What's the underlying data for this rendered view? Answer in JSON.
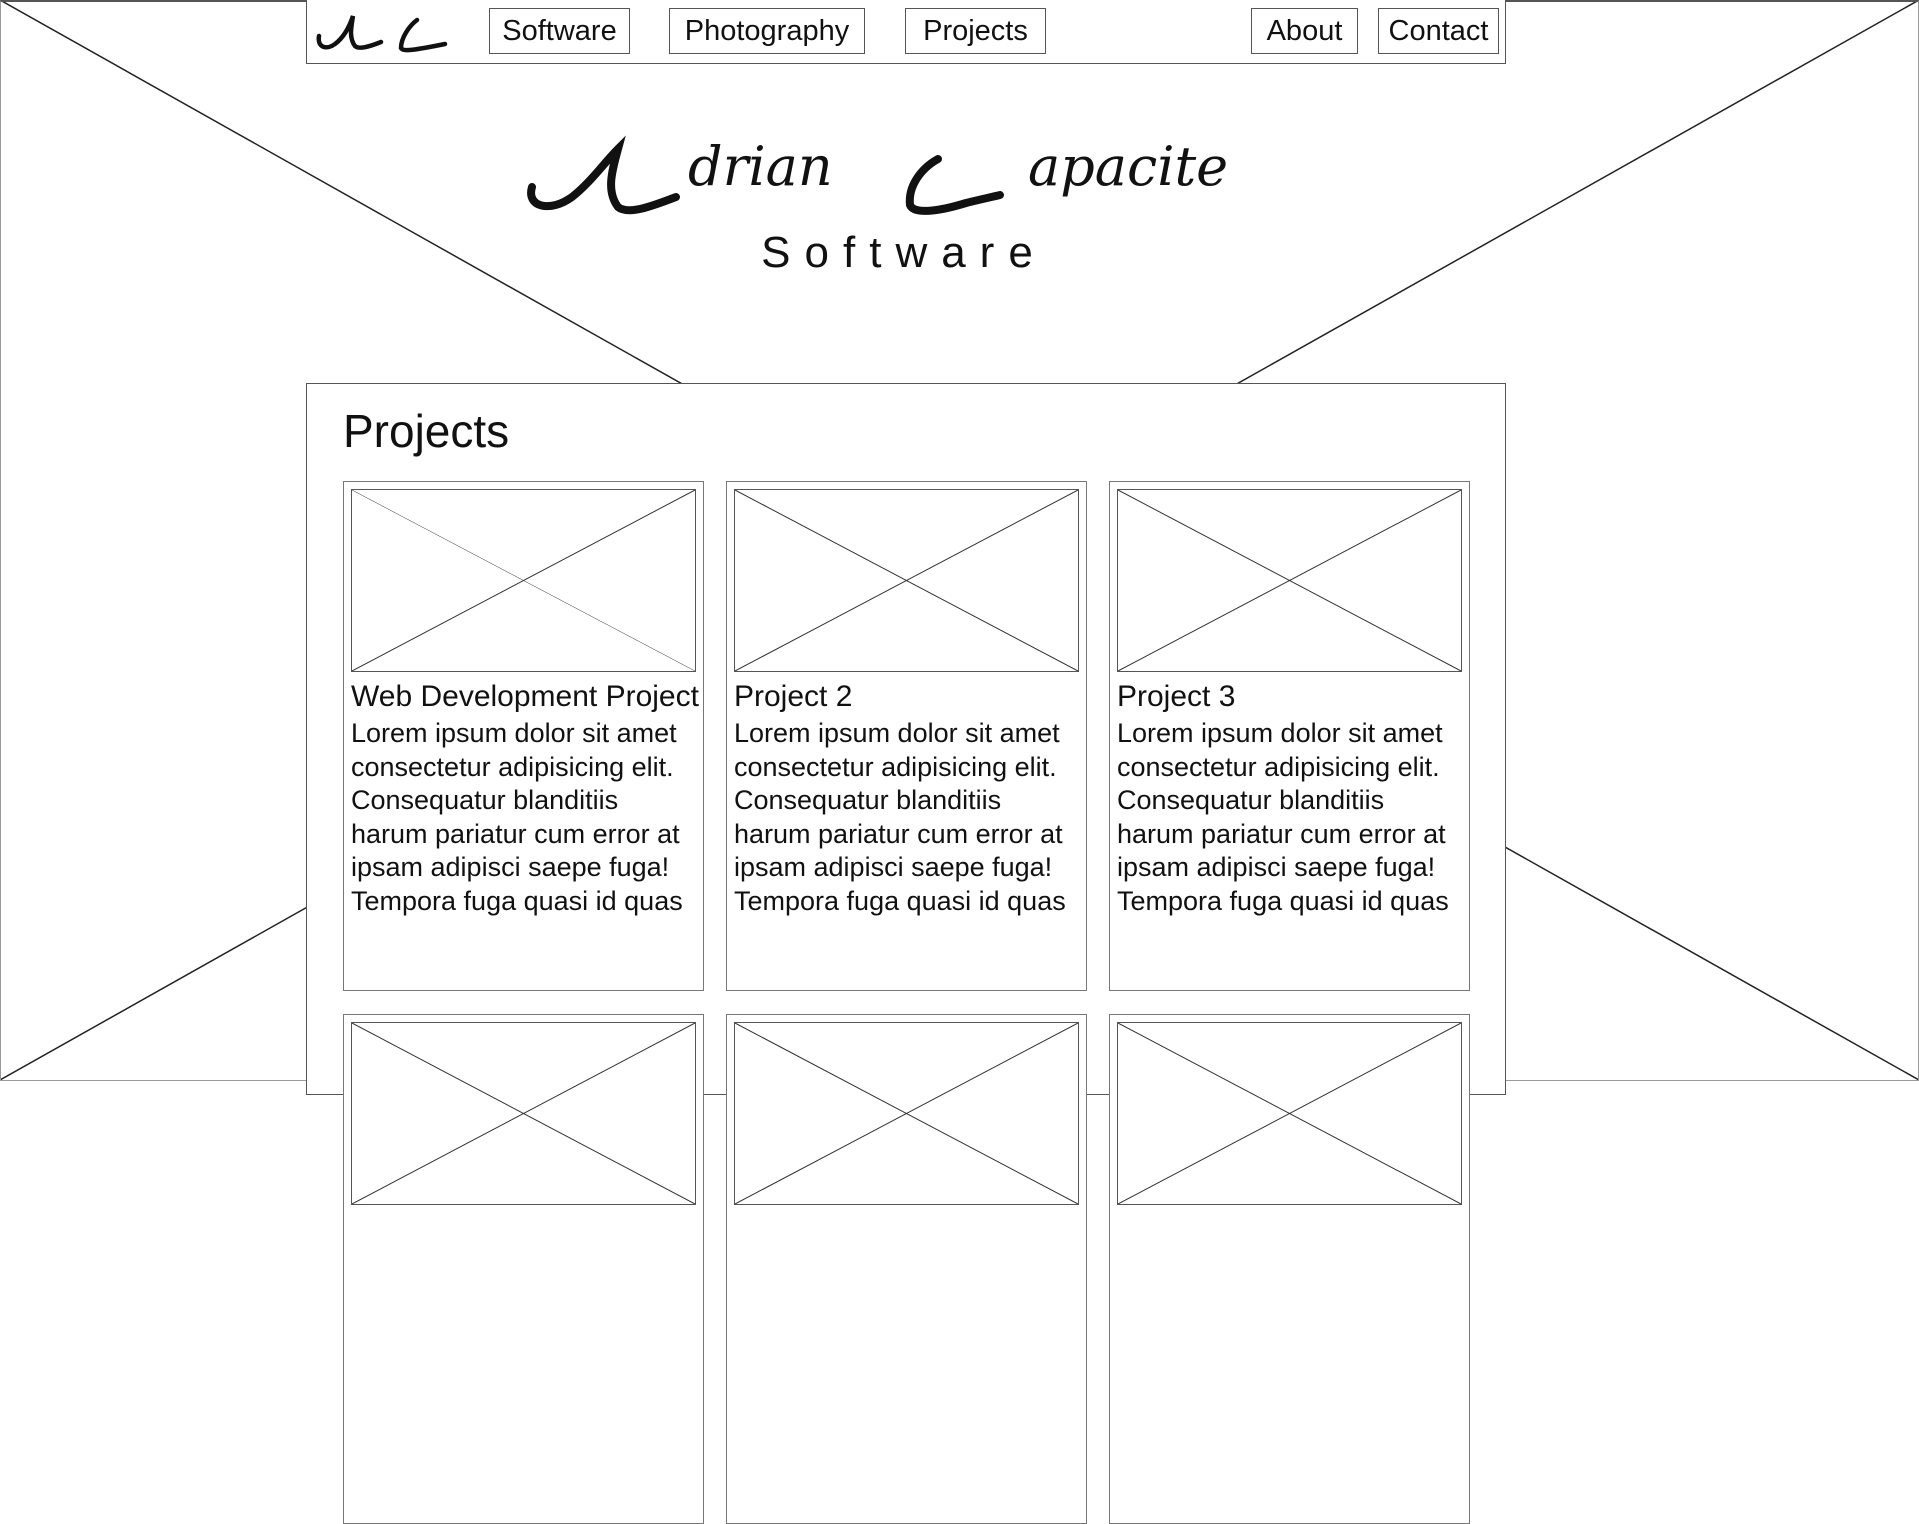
{
  "nav": {
    "logo_icon": "ac-monogram-logo",
    "items": [
      {
        "label": "Software"
      },
      {
        "label": "Photography"
      },
      {
        "label": "Projects"
      },
      {
        "label": "About"
      },
      {
        "label": "Contact"
      }
    ]
  },
  "hero": {
    "title": "Adrian Capacite",
    "subtitle": "Software"
  },
  "projects": {
    "heading": "Projects",
    "cards": [
      {
        "title": "Web Development Project",
        "body": "Lorem ipsum dolor sit amet consectetur adipisicing elit. Consequatur blanditiis harum pariatur cum error at ipsam adipisci saepe fuga! Tempora fuga quasi id quas",
        "image": "image-placeholder"
      },
      {
        "title": "Project 2",
        "body": "Lorem ipsum dolor sit amet consectetur adipisicing elit. Consequatur blanditiis harum pariatur cum error at ipsam adipisci saepe fuga! Tempora fuga quasi id quas",
        "image": "image-placeholder"
      },
      {
        "title": "Project 3",
        "body": "Lorem ipsum dolor sit amet consectetur adipisicing elit. Consequatur blanditiis harum pariatur cum error at ipsam adipisci saepe fuga! Tempora fuga quasi id quas",
        "image": "image-placeholder"
      },
      {
        "title": "",
        "body": "",
        "image": "image-placeholder"
      },
      {
        "title": "",
        "body": "",
        "image": "image-placeholder"
      },
      {
        "title": "",
        "body": "",
        "image": "image-placeholder"
      }
    ]
  },
  "background": {
    "image": "image-placeholder-cross"
  }
}
